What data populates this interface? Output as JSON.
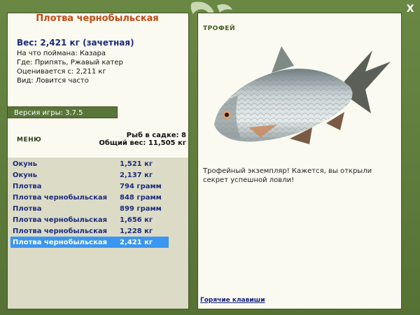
{
  "fish": {
    "title": "Плотва чернобыльская",
    "weight": "Вес: 2,421 кг (зачетная)",
    "details": [
      "На что поймана: Казара",
      "Где: Припять, Ржавый катер",
      "Оценивается с: 2,211 кг",
      "Вид: Ловится часто"
    ]
  },
  "version": "Версия игры: 3.7.5",
  "menu_label": "МЕНЮ",
  "sadok": {
    "count": "Рыб в садке: 8",
    "total": "Общий вес: 11,505 кг"
  },
  "catches": [
    {
      "name": "Окунь",
      "weight": "1,521 кг"
    },
    {
      "name": "Окунь",
      "weight": "2,137 кг"
    },
    {
      "name": "Плотва",
      "weight": "794 грамм"
    },
    {
      "name": "Плотва чернобыльская",
      "weight": "848 грамм"
    },
    {
      "name": "Плотва",
      "weight": "899 грамм"
    },
    {
      "name": "Плотва чернобыльская",
      "weight": "1,656 кг"
    },
    {
      "name": "Плотва чернобыльская",
      "weight": "1,228 кг"
    },
    {
      "name": "Плотва чернобыльская",
      "weight": "2,421 кг"
    }
  ],
  "selected_index": 7,
  "trophy": {
    "label": "ТРОФЕЙ",
    "text": "Трофейный экземпляр! Кажется, вы открыли секрет успешной ловли!"
  },
  "hotkeys": "Горячие клавиши",
  "close": "X",
  "icons": {
    "close": "close-icon",
    "emblem": "fish-emblem-icon"
  }
}
